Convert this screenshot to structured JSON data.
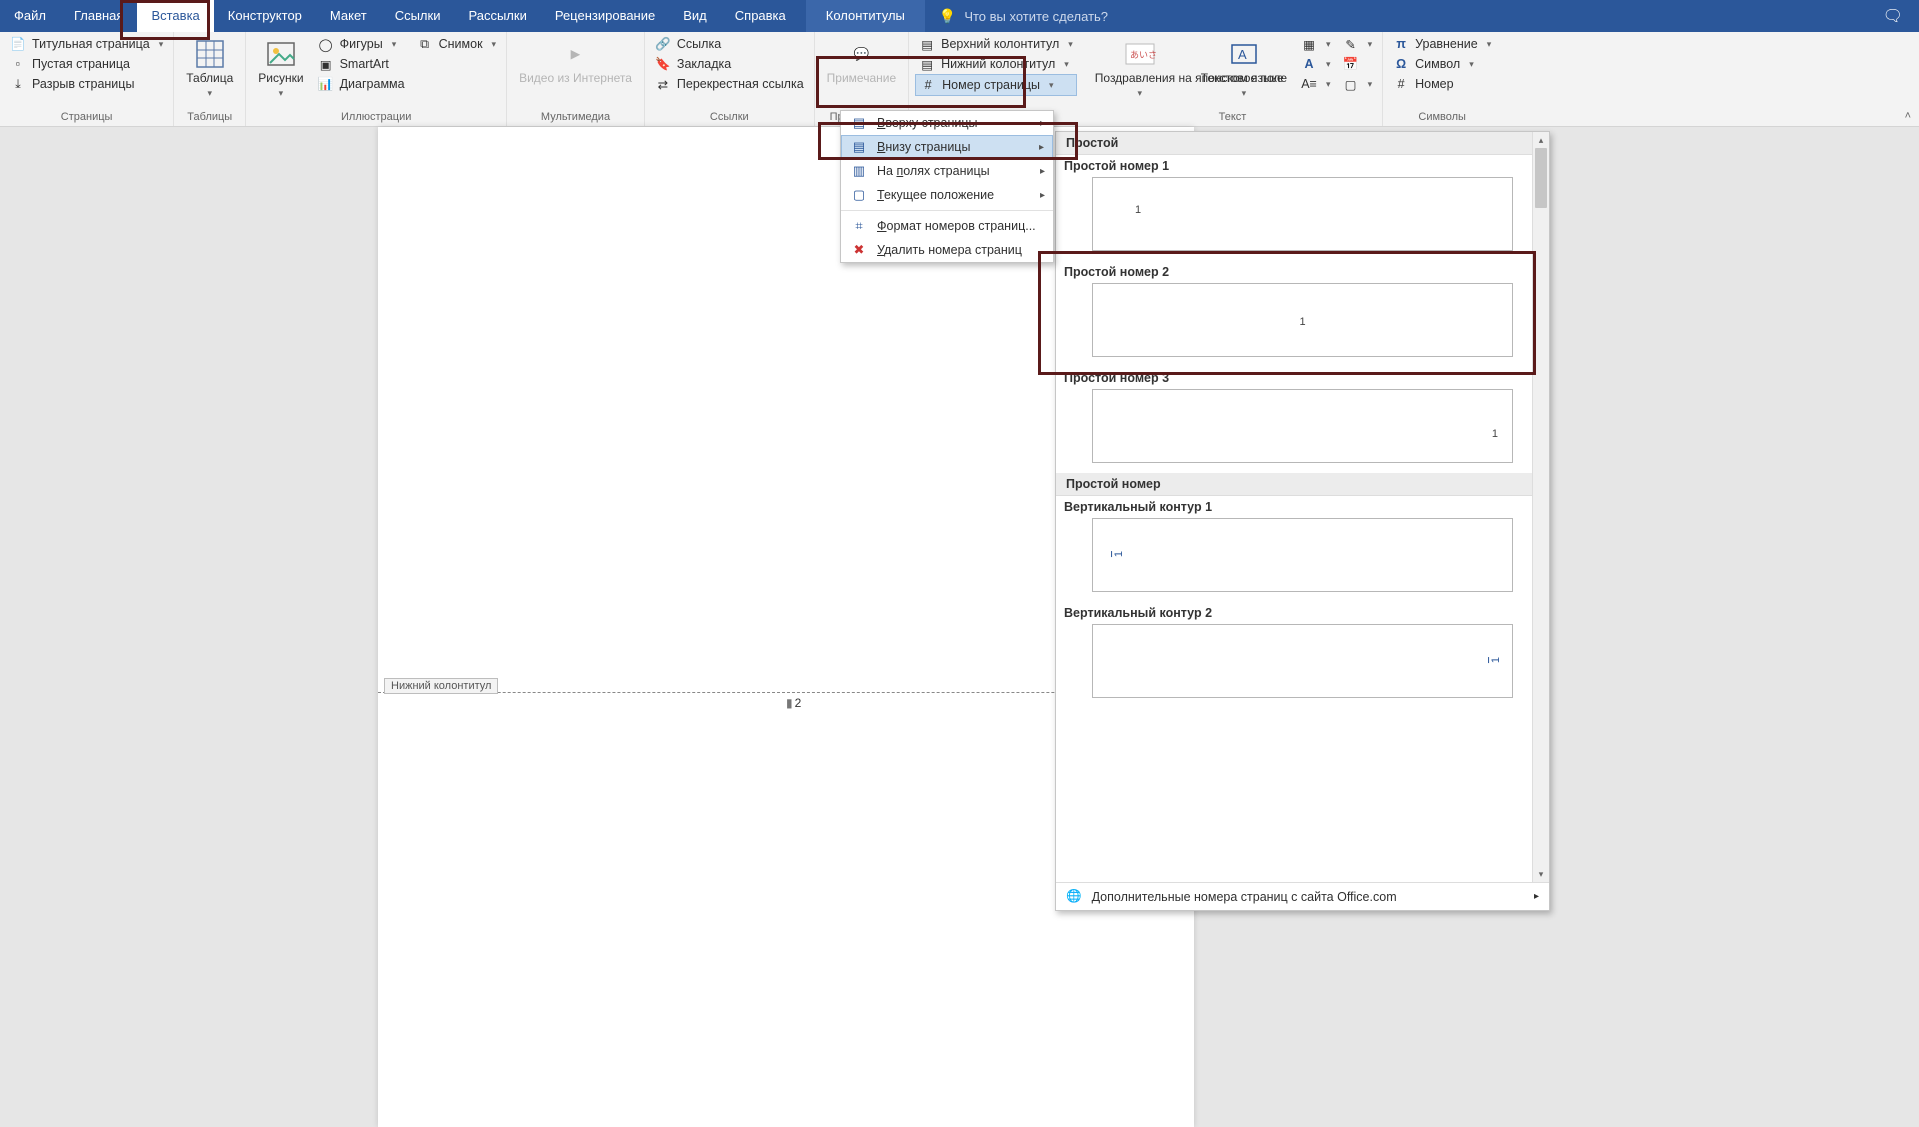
{
  "tabs": {
    "file": "Файл",
    "home": "Главная",
    "insert": "Вставка",
    "design": "Конструктор",
    "layout": "Макет",
    "references": "Ссылки",
    "mailings": "Рассылки",
    "review": "Рецензирование",
    "view": "Вид",
    "help": "Справка",
    "contextual": "Колонтитулы",
    "tellme_placeholder": "Что вы хотите сделать?"
  },
  "ribbon": {
    "pages": {
      "cover_page": "Титульная страница",
      "blank_page": "Пустая страница",
      "page_break": "Разрыв страницы",
      "group": "Страницы"
    },
    "tables": {
      "table": "Таблица",
      "group": "Таблицы"
    },
    "illustrations": {
      "pictures": "Рисунки",
      "shapes": "Фигуры",
      "smartart": "SmartArt",
      "chart": "Диаграмма",
      "screenshot": "Снимок",
      "group": "Иллюстрации"
    },
    "media": {
      "online_video": "Видео из Интернета",
      "group": "Мультимедиа"
    },
    "links": {
      "link": "Ссылка",
      "bookmark": "Закладка",
      "cross_ref": "Перекрестная ссылка",
      "group": "Ссылки"
    },
    "comments": {
      "comment": "Примечание",
      "group": "Примечания"
    },
    "header_footer": {
      "header": "Верхний колонтитул",
      "footer": "Нижний колонтитул",
      "page_number": "Номер страницы"
    },
    "text": {
      "greetings": "Поздравления на японском языке",
      "text_box": "Текстовое поле",
      "group": "Текст"
    },
    "symbols": {
      "equation": "Уравнение",
      "symbol": "Символ",
      "number": "Номер",
      "group": "Символы"
    }
  },
  "page_number_menu": {
    "top": "Вверху страницы",
    "bottom": "Внизу страницы",
    "margins": "На полях страницы",
    "current": "Текущее положение",
    "format": "Формат номеров страниц...",
    "remove": "Удалить номера страниц",
    "underline_chars": {
      "top": "В",
      "bottom": "В",
      "margins": "п",
      "current": "Т",
      "format": "Ф",
      "remove": "У"
    }
  },
  "gallery": {
    "section_simple": "Простой",
    "items": [
      {
        "label": "Простой номер 1",
        "align": "left"
      },
      {
        "label": "Простой номер 2",
        "align": "center"
      },
      {
        "label": "Простой номер 3",
        "align": "right"
      }
    ],
    "section_plain": "Простой номер",
    "items2": [
      {
        "label": "Вертикальный контур 1",
        "align": "left-vert"
      },
      {
        "label": "Вертикальный контур 2",
        "align": "right-vert"
      }
    ],
    "more_office": "Дополнительные номера страниц с сайта Office.com"
  },
  "document": {
    "footer_label": "Нижний колонтитул",
    "page_number_value": "2"
  }
}
